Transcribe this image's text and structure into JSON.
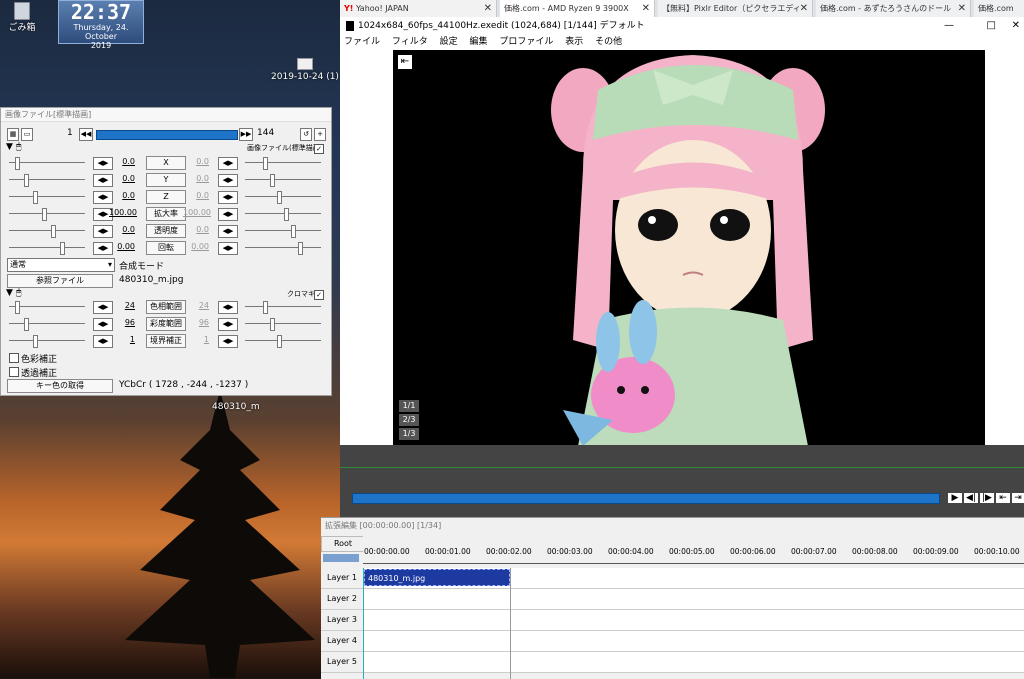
{
  "desktop": {
    "trash_label": "ごみ箱",
    "clock_time": "22:37",
    "clock_date": "Thursday, 24. October",
    "clock_year": "2019",
    "folder_label": "2019-10-24 (1)",
    "file_label": "480310_m"
  },
  "browser_tabs": [
    {
      "label": "Yahoo! JAPAN"
    },
    {
      "label": "価格.com - AMD Ryzen 9 3900X"
    },
    {
      "label": "【無料】Pixlr Editor（ピクセラエディ"
    },
    {
      "label": "価格.com - あずたろうさんのドール"
    },
    {
      "label": "価格.com"
    }
  ],
  "prop": {
    "title": "画像ファイル[標準描画]",
    "frame_start": "1",
    "frame_end": "144",
    "section1_label": "画像ファイル(標準描画)",
    "rows": [
      {
        "left": "0.0",
        "label": "X",
        "right": "0.0"
      },
      {
        "left": "0.0",
        "label": "Y",
        "right": "0.0"
      },
      {
        "left": "0.0",
        "label": "Z",
        "right": "0.0"
      },
      {
        "left": "100.00",
        "label": "拡大率",
        "right": "100.00"
      },
      {
        "left": "0.0",
        "label": "透明度",
        "right": "0.0"
      },
      {
        "left": "0.00",
        "label": "回転",
        "right": "0.00"
      }
    ],
    "blend_select": "通常",
    "blend_label": "合成モード",
    "ref_button": "参照ファイル",
    "ref_file": "480310_m.jpg",
    "section2_label": "クロマキー",
    "chroma_rows": [
      {
        "left": "24",
        "label": "色相範囲",
        "right": "24"
      },
      {
        "left": "96",
        "label": "彩度範囲",
        "right": "96"
      },
      {
        "left": "1",
        "label": "境界補正",
        "right": "1"
      }
    ],
    "check1": "色彩補正",
    "check2": "透過補正",
    "key_button": "キー色の取得",
    "key_value": "YCbCr ( 1728 , -244 , -1237 )"
  },
  "editwin": {
    "title": "1024x684_60fps_44100Hz.exedit (1024,684)  [1/144]  デフォルト",
    "menu": [
      "ファイル",
      "フィルタ",
      "設定",
      "編集",
      "プロファイル",
      "表示",
      "その他"
    ],
    "frame_markers": [
      "1/1",
      "2/3",
      "1/3"
    ],
    "window_controls": [
      "—",
      "□",
      "✕"
    ]
  },
  "timeline": {
    "title": "拡張編集 [00:00:00.00] [1/34]",
    "root": "Root",
    "ticks": [
      "00:00:00.00",
      "00:00:01.00",
      "00:00:02.00",
      "00:00:03.00",
      "00:00:04.00",
      "00:00:05.00",
      "00:00:06.00",
      "00:00:07.00",
      "00:00:08.00",
      "00:00:09.00",
      "00:00:10.00"
    ],
    "layers": [
      "Layer 1",
      "Layer 2",
      "Layer 3",
      "Layer 4",
      "Layer 5"
    ],
    "clip_label": "480310_m.jpg"
  },
  "colors": {
    "accent_blue": "#1e74c8",
    "clip_blue": "#1c3aa0"
  }
}
